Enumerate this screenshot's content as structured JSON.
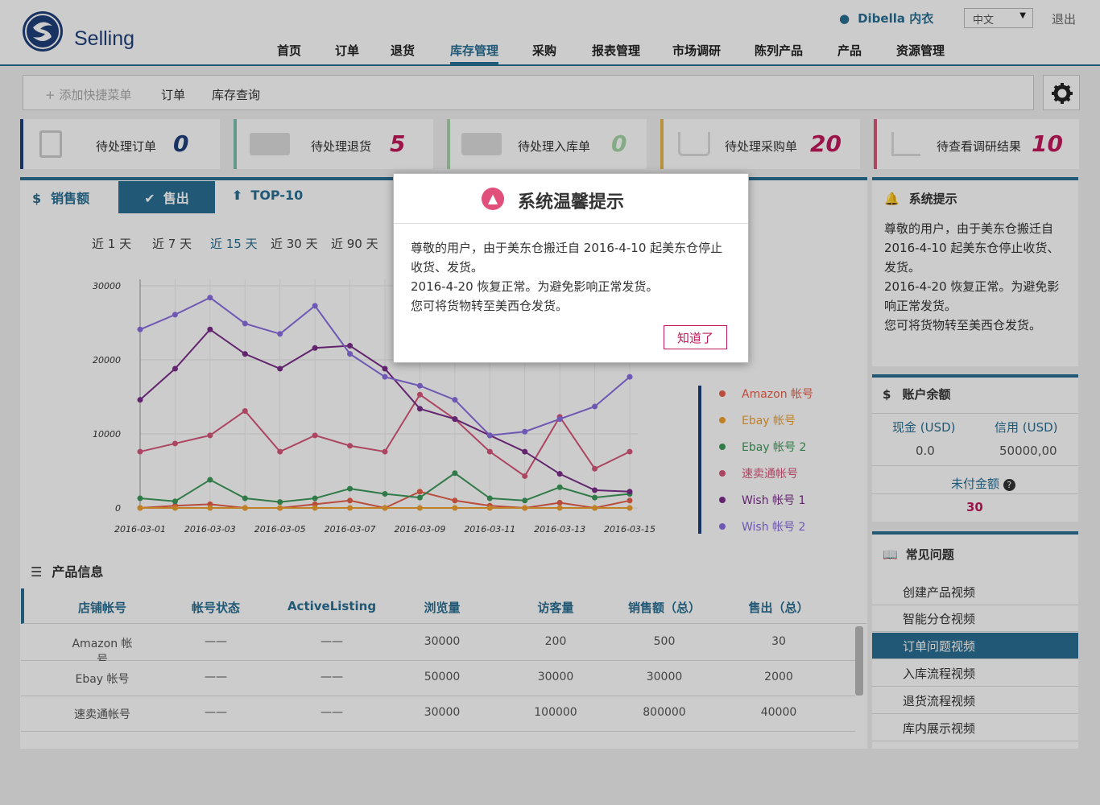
{
  "app": {
    "name": "Selling"
  },
  "nav": [
    "首页",
    "订单",
    "退货",
    "库存管理",
    "采购",
    "报表管理",
    "市场调研",
    "陈列产品",
    "产品",
    "资源管理"
  ],
  "user": {
    "name": "Dibella 内衣",
    "lang": "中文",
    "logout": "退出"
  },
  "quickbar": {
    "add": "+ 添加快捷菜单",
    "items": [
      "订单",
      "库存查询"
    ]
  },
  "stats": [
    {
      "label": "待处理订单",
      "value": "0",
      "color": "#1f3f7a"
    },
    {
      "label": "待处理退货",
      "value": "5",
      "color": "#c2185b"
    },
    {
      "label": "待处理入库单",
      "value": "0",
      "color": "#66bb6a"
    },
    {
      "label": "待处理采购单",
      "value": "20",
      "color": "#c2185b"
    },
    {
      "label": "待查看调研结果",
      "value": "10",
      "color": "#c2185b"
    }
  ],
  "chart_panel": {
    "tabs": [
      "销售额",
      "售出",
      "TOP-10"
    ],
    "active_tab": "售出",
    "ranges": [
      "近 1 天",
      "近 7 天",
      "近 15 天",
      "近 30 天",
      "近 90 天"
    ],
    "active_range": "近 15 天"
  },
  "chart_data": {
    "type": "line",
    "x": [
      "2016-03-01",
      "2016-03-02",
      "2016-03-03",
      "2016-03-04",
      "2016-03-05",
      "2016-03-06",
      "2016-03-07",
      "2016-03-08",
      "2016-03-09",
      "2016-03-10",
      "2016-03-11",
      "2016-03-12",
      "2016-03-13",
      "2016-03-14",
      "2016-03-15"
    ],
    "xticks": [
      "2016-03-01",
      "2016-03-03",
      "2016-03-05",
      "2016-03-07",
      "2016-03-09",
      "2016-03-11",
      "2016-03-13",
      "2016-03-15"
    ],
    "yticks": [
      "0",
      "10000",
      "20000",
      "30000"
    ],
    "ylim": [
      0,
      30000
    ],
    "series": [
      {
        "name": "Amazon 帐号",
        "color": "#e8604a",
        "values": [
          0,
          300,
          500,
          0,
          0,
          500,
          1000,
          0,
          2200,
          1000,
          300,
          0,
          700,
          0,
          1000
        ]
      },
      {
        "name": "Ebay 帐号",
        "color": "#f0a030",
        "values": [
          0,
          0,
          0,
          0,
          0,
          0,
          0,
          0,
          0,
          0,
          0,
          0,
          0,
          0,
          0
        ]
      },
      {
        "name": "Ebay 帐号 2",
        "color": "#3e9a5a",
        "values": [
          1300,
          900,
          3800,
          1300,
          800,
          1300,
          2600,
          1900,
          1400,
          4700,
          1300,
          1000,
          2800,
          1400,
          1900
        ]
      },
      {
        "name": "速卖通帐号",
        "color": "#d7577b",
        "values": [
          7600,
          8700,
          9800,
          13100,
          7600,
          9800,
          8400,
          7600,
          15300,
          12000,
          7600,
          4300,
          12300,
          5300,
          7600
        ]
      },
      {
        "name": "Wish 帐号 1",
        "color": "#7b2e8a",
        "values": [
          14600,
          18800,
          24100,
          20800,
          18800,
          21600,
          21900,
          18800,
          13400,
          12000,
          9800,
          7600,
          4600,
          2400,
          2200
        ]
      },
      {
        "name": "Wish 帐号 2",
        "color": "#8b6ee0",
        "values": [
          24100,
          26100,
          28400,
          24900,
          23500,
          27300,
          20800,
          17700,
          16500,
          14600,
          9800,
          10300,
          12000,
          13700,
          17700
        ]
      }
    ]
  },
  "products": {
    "title": "产品信息",
    "headers": [
      "店铺帐号",
      "帐号状态",
      "ActiveListing",
      "浏览量",
      "访客量",
      "销售额（总）",
      "售出（总）"
    ],
    "rows": [
      [
        "Amazon 帐号",
        "——",
        "——",
        "30000",
        "200",
        "500",
        "30"
      ],
      [
        "Ebay 帐号",
        "——",
        "——",
        "50000",
        "30000",
        "30000",
        "2000"
      ],
      [
        "速卖通帐号",
        "——",
        "——",
        "30000",
        "100000",
        "800000",
        "40000"
      ]
    ]
  },
  "notice": {
    "title": "系统提示",
    "lines": [
      "尊敬的用户，由于美东仓搬迁自",
      "2016-4-10 起美东仓停止收货、",
      "发货。",
      "2016-4-20 恢复正常。为避免影",
      "响正常发货。",
      "您可将货物转至美西仓发货。"
    ]
  },
  "balance": {
    "title": "账户余额",
    "cash_label": "现金 (USD)",
    "credit_label": "信用 (USD)",
    "cash": "0.0",
    "credit": "50000,00",
    "unpaid_label": "未付金额",
    "unpaid": "30"
  },
  "faq": {
    "title": "常见问题",
    "items": [
      "创建产品视频",
      "智能分仓视频",
      "订单问题视频",
      "入库流程视频",
      "退货流程视频",
      "库内展示视频"
    ],
    "active": "订单问题视频"
  },
  "modal": {
    "title": "系统温馨提示",
    "lines": [
      "尊敬的用户，由于美东仓搬迁自 2016-4-10 起美东仓停止",
      "收货、发货。",
      "2016-4-20 恢复正常。为避免影响正常发货。",
      "您可将货物转至美西仓发货。"
    ],
    "ok": "知道了"
  }
}
